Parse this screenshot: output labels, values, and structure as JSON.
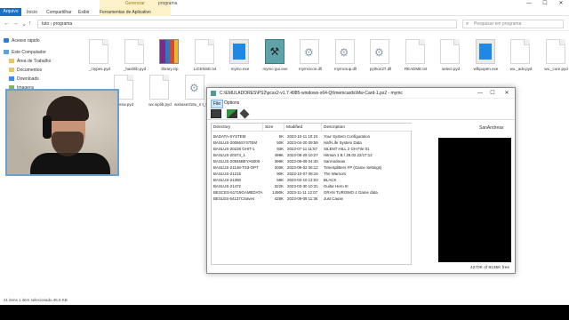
{
  "explorer": {
    "tabs": {
      "file": "Arquivo",
      "home": "Início",
      "share": "Compartilhar",
      "view": "Exibir",
      "app_tools": "Ferramentas de Aplicativo",
      "manage": "Gerenciar"
    },
    "window_title": "programa",
    "path": "tuto  ›  programa",
    "search_placeholder": "Pesquisar em programa",
    "sidebar": [
      {
        "label": "Acesso rápido",
        "icon": "star-icon"
      },
      {
        "label": "Este Computador",
        "icon": "computer-icon"
      },
      {
        "label": "Área de Trabalho",
        "icon": "folder-icon"
      },
      {
        "label": "Documentos",
        "icon": "folder-icon"
      },
      {
        "label": "Downloads",
        "icon": "download-icon"
      },
      {
        "label": "Imagens",
        "icon": "image-icon"
      }
    ],
    "files": [
      {
        "name": "_ctypes.pyd",
        "type": "doc"
      },
      {
        "name": "_hashlib.pyd",
        "type": "doc"
      },
      {
        "name": "library.zip",
        "type": "zip"
      },
      {
        "name": "LICENSE.txt",
        "type": "doc"
      },
      {
        "name": "mymc.exe",
        "type": "exe"
      },
      {
        "name": "mymc-gui.exe",
        "type": "mymcgui"
      },
      {
        "name": "mymcicon.dll",
        "type": "gear"
      },
      {
        "name": "mymcsup.dll",
        "type": "gear"
      },
      {
        "name": "python27.dll",
        "type": "gear"
      },
      {
        "name": "README.txt",
        "type": "doc"
      },
      {
        "name": "select.pyd",
        "type": "doc"
      },
      {
        "name": "wfkpopen.exe",
        "type": "exe"
      },
      {
        "name": "wx._adv.pyd",
        "type": "doc"
      },
      {
        "name": "wx._core.pyd",
        "type": "doc"
      },
      {
        "name": "_msw.pyd",
        "type": "doc"
      },
      {
        "name": "wx.siplib.pyd",
        "type": "doc"
      },
      {
        "name": "wxbase318u_n\nt_vc90.dll",
        "type": "gear"
      }
    ],
    "status": "21 itens     1 item selecionado  45,5 KB"
  },
  "mymc": {
    "title": "C:\\EMULADORES\\PS2\\pcsx2-v1.7.4985-windows-x64-Qt\\memcards\\Mw-Card-1.ps2 - mymc",
    "menu": {
      "file": "File",
      "options": "Options"
    },
    "columns": {
      "directory": "Directory",
      "size": "Size",
      "modified": "Modified",
      "description": "Description"
    },
    "rows": [
      {
        "directory": "BADATA-SYSTEM",
        "size": "5K",
        "modified": "2023-10-11 10:24",
        "description": "Your System Configuration"
      },
      {
        "directory": "BASLUS-20066SYSTEM",
        "size": "50K",
        "modified": "2023-04-20 09:59",
        "description": "Half-Life System Data"
      },
      {
        "directory": "BASLUS-20228 GHIT-1",
        "size": "93K",
        "modified": "2023-07-11 11:57",
        "description": "SILENT HILL 2 GH File 01"
      },
      {
        "directory": "BASLUS-20374_1",
        "size": "499K",
        "modified": "2023-08-29 10:27",
        "description": "Hitman 2 B / 28.02.22/17:12"
      },
      {
        "directory": "BASLUS-20946BEYA5000",
        "size": "399K",
        "modified": "2023-09-09 04:40",
        "description": "SanAndreas"
      },
      {
        "directory": "BASLUS-21148-TS3-OPT",
        "size": "200K",
        "modified": "2023-09-02 06:12",
        "description": "TimeSplitters FP (Game Settings)"
      },
      {
        "directory": "BASLUS-21215",
        "size": "90K",
        "modified": "2023-10-07 08:16",
        "description": "The Warriors"
      },
      {
        "directory": "BASLUS-21350",
        "size": "58K",
        "modified": "2023-03-10 12:03",
        "description": "BLACK"
      },
      {
        "directory": "BASLUS-21472",
        "size": "322K",
        "modified": "2023-03-30 10:31",
        "description": "Guitar Hero III"
      },
      {
        "directory": "BESCES-51719GAMEDATA",
        "size": "1490K",
        "modified": "2023-11-11 12:07",
        "description": "GRAN TURISMO 4 Game data"
      },
      {
        "directory": "BESLES-54137CSaves",
        "size": "428K",
        "modified": "2023-09-08 11:36",
        "description": "Just Cause"
      }
    ],
    "selected_save_title": "SanAndreas",
    "free_space": "4270K of 8135K free"
  }
}
